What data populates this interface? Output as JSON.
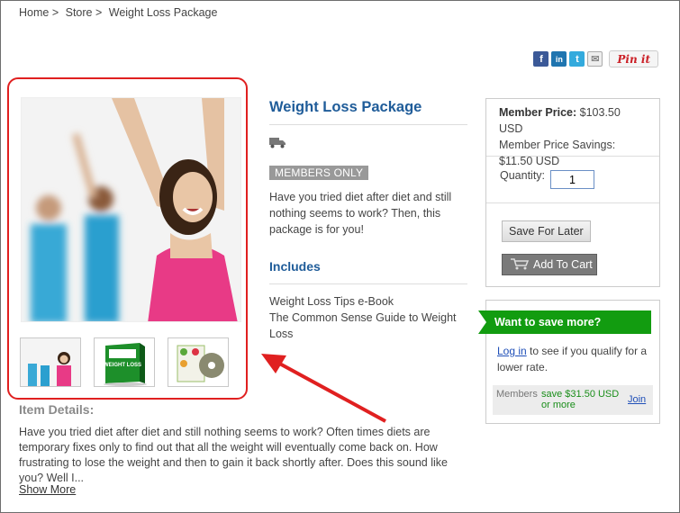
{
  "breadcrumb": [
    "Home >",
    "Store >",
    "Weight Loss Package"
  ],
  "share": {
    "facebook": "f",
    "linkedin": "in",
    "twitter": "t",
    "email": "✉",
    "pinterest": "Pin it"
  },
  "product": {
    "title": "Weight Loss Package",
    "badge": "MEMBERS ONLY",
    "description": "Have you tried diet after diet and still nothing seems to work? Then, this package is for you!",
    "includes_heading": "Includes",
    "includes": [
      "Weight Loss Tips e-Book",
      "The Common Sense Guide to Weight Loss"
    ]
  },
  "pricing": {
    "member_price_label": "Member Price:",
    "member_price": "$103.50 USD",
    "savings_label": "Member Price Savings:",
    "savings": "$11.50 USD",
    "quantity_label": "Quantity:",
    "quantity": "1",
    "save_later": "Save For Later",
    "add_to_cart": "Add To Cart"
  },
  "save_more": {
    "banner": "Want to save more?",
    "login_link": "Log in",
    "login_text": " to see if you qualify for a lower rate.",
    "members_label": "Members",
    "members_save": "save $31.50 USD or more",
    "join": "Join"
  },
  "details": {
    "heading": "Item Details:",
    "text": "Have you tried diet after diet and still nothing seems to work?  Often times diets are temporary fixes only to find out that all the weight will eventually come back on.  How frustrating to lose the weight and then to gain it back shortly after.  Does this sound like you?  Well I...",
    "show_more": "Show More"
  },
  "thumbnail_text": "WEIGHT LOSS",
  "colors": {
    "title_blue": "#1f5c99",
    "highlight_red": "#e02020",
    "banner_green": "#129c10"
  }
}
